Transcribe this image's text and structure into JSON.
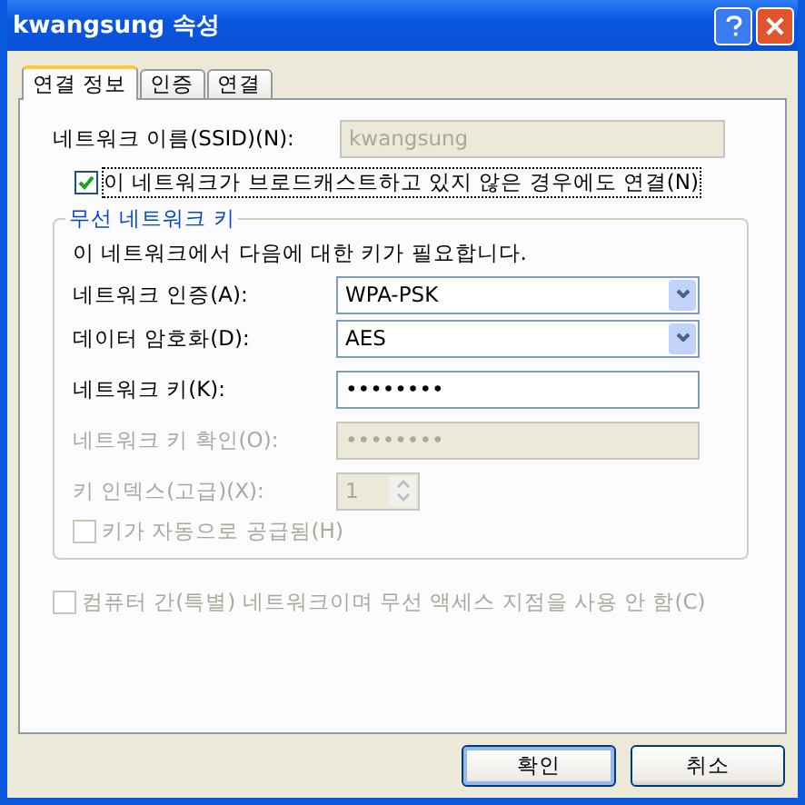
{
  "window": {
    "title": "kwangsung 속성"
  },
  "tabs": [
    {
      "label": "연결 정보",
      "selected": true
    },
    {
      "label": "인증",
      "selected": false
    },
    {
      "label": "연결",
      "selected": false
    }
  ],
  "ssid": {
    "label": "네트워크 이름(SSID)(N):",
    "value": "kwangsung",
    "disabled": true
  },
  "broadcast_checkbox": {
    "label": "이 네트워크가 브로드캐스트하고 있지 않은 경우에도 연결(N)",
    "checked": true,
    "disabled": false
  },
  "key_group": {
    "title": "무선 네트워크 키",
    "description": "이 네트워크에서 다음에 대한 키가 필요합니다.",
    "fields": [
      {
        "kind": "select",
        "label": "네트워크 인증(A):",
        "value": "WPA-PSK",
        "disabled": false
      },
      {
        "kind": "select",
        "label": "데이터 암호화(D):",
        "value": "AES",
        "disabled": false
      },
      {
        "kind": "password",
        "label": "네트워크 키(K):",
        "value": "••••••••",
        "disabled": false
      },
      {
        "kind": "password",
        "label": "네트워크 키 확인(O):",
        "value": "••••••••",
        "disabled": true
      },
      {
        "kind": "spinner",
        "label": "키 인덱스(고급)(X):",
        "value": "1",
        "disabled": true
      }
    ],
    "auto_key_checkbox": {
      "label": "키가 자동으로 공급됨(H)",
      "checked": false,
      "disabled": true
    }
  },
  "adhoc_checkbox": {
    "label": "컴퓨터 간(특별) 네트워크이며 무선 액세스 지점을 사용 안 함(C)",
    "checked": false,
    "disabled": true
  },
  "buttons": [
    {
      "label": "확인",
      "default": true
    },
    {
      "label": "취소",
      "default": false
    }
  ]
}
